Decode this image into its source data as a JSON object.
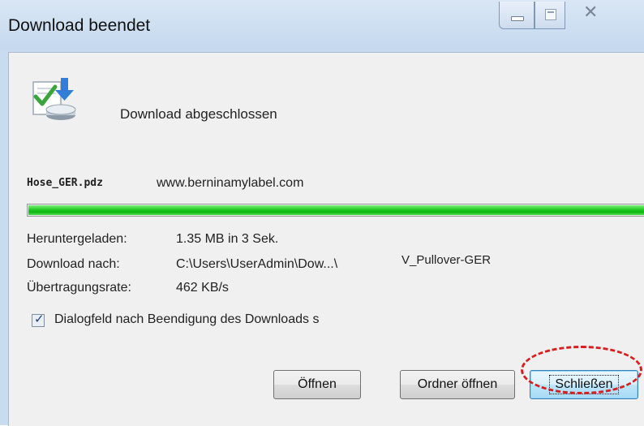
{
  "window": {
    "title": "Download beendet"
  },
  "caption_buttons": {
    "minimize_icon": "minimize-icon",
    "maximize_icon": "maximize-icon",
    "close_icon": "close-icon",
    "close_glyph": "✕"
  },
  "header": {
    "icon": "download-complete-icon",
    "message": "Download abgeschlossen"
  },
  "file": {
    "name": "Hose_GER.pdz",
    "source": "www.berninamylabel.com"
  },
  "progress": {
    "percent": 100,
    "color": "#22c822"
  },
  "details": {
    "downloaded_label": "Heruntergeladen:",
    "downloaded_value": "1.35 MB in 3 Sek.",
    "destination_label": "Download nach:",
    "destination_value": "C:\\Users\\UserAdmin\\Dow...\\",
    "destination_suffix": "V_Pullover-GER",
    "rate_label": "Übertragungsrate:",
    "rate_value": "462 KB/s"
  },
  "option": {
    "checked": true,
    "label": "Dialogfeld nach Beendigung des Downloads s"
  },
  "buttons": {
    "open": "Öffnen",
    "open_folder": "Ordner öffnen",
    "close": "Schließen"
  },
  "annotation": {
    "color": "#d61f1f",
    "target": "close-button"
  }
}
